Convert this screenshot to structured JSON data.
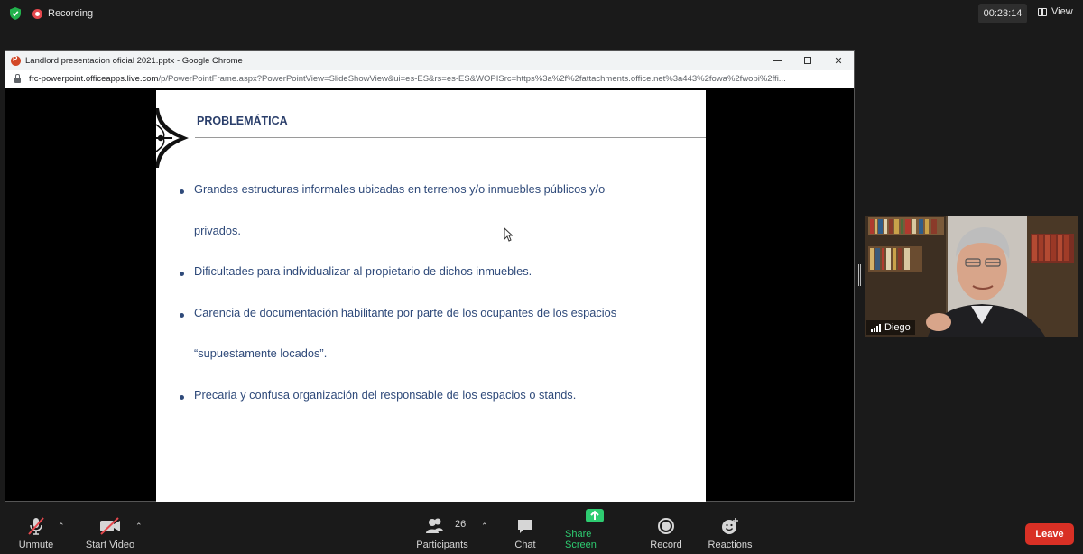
{
  "topbar": {
    "recording_label": "Recording",
    "timer": "00:23:14",
    "view_label": "View",
    "colors": {
      "shield": "#22b14c",
      "record": "#e5484d"
    }
  },
  "browser": {
    "window_title": "Landlord presentacion oficial 2021.pptx - Google Chrome",
    "url_domain": "frc-powerpoint.officeapps.live.com",
    "url_rest": "/p/PowerPointFrame.aspx?PowerPointView=SlideShowView&ui=es-ES&rs=es-ES&WOPISrc=https%3a%2f%2fattachments.office.net%3a443%2fowa%2fwopi%2ffi..."
  },
  "slide": {
    "title": "PROBLEMÁTICA",
    "bullets": [
      {
        "lines": [
          "Grandes estructuras informales ubicadas en terrenos y/o inmuebles públicos y/o",
          "privados."
        ]
      },
      {
        "lines": [
          "Dificultades para individualizar al propietario de dichos inmuebles."
        ]
      },
      {
        "lines": [
          "Carencia de documentación habilitante por parte de los ocupantes de los espacios",
          "“supuestamente locados”."
        ]
      },
      {
        "lines": [
          "Precaria y confusa organización del responsable de los espacios o stands."
        ]
      }
    ],
    "text_color": "#2f4a7a"
  },
  "participant": {
    "name": "Diego"
  },
  "toolbar": {
    "unmute": "Unmute",
    "start_video": "Start Video",
    "participants": "Participants",
    "participant_count": "26",
    "chat": "Chat",
    "share_screen": "Share Screen",
    "record": "Record",
    "reactions": "Reactions",
    "leave": "Leave",
    "colors": {
      "share": "#2ecc71",
      "leave": "#d93025"
    }
  }
}
